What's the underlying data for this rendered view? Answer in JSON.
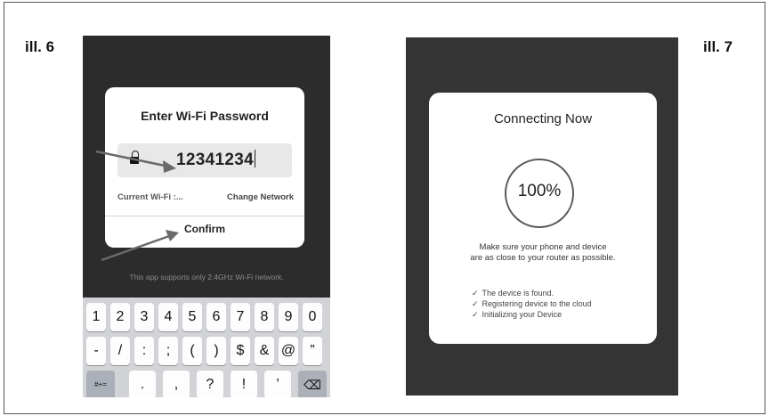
{
  "figure_labels": {
    "left": "ill. 6",
    "right": "ill. 7"
  },
  "password_dialog": {
    "title": "Enter Wi-Fi Password",
    "password_value": "12341234",
    "current_wifi_label": "Current Wi-Fi :...",
    "change_network_label": "Change Network",
    "confirm_label": "Confirm",
    "support_note": "This app supports only 2.4GHz Wi-Fi network."
  },
  "keyboard": {
    "row1": [
      "1",
      "2",
      "3",
      "4",
      "5",
      "6",
      "7",
      "8",
      "9",
      "0"
    ],
    "row2": [
      "-",
      "/",
      ":",
      ";",
      "(",
      ")",
      "$",
      "&",
      "@",
      "”"
    ],
    "row3": [
      "#+=",
      ".",
      ",",
      "?",
      "!",
      "’",
      "⌫"
    ]
  },
  "connecting": {
    "title": "Connecting Now",
    "progress_percent": 100,
    "progress_label": "100%",
    "hint_line1": "Make sure your phone and device",
    "hint_line2": "are as close to your router as possible.",
    "steps": [
      {
        "check": "✓",
        "label": "The device is found."
      },
      {
        "check": "✓",
        "label": "Registering device to the cloud"
      },
      {
        "check": "✓",
        "label": "Initializing your Device"
      }
    ]
  }
}
